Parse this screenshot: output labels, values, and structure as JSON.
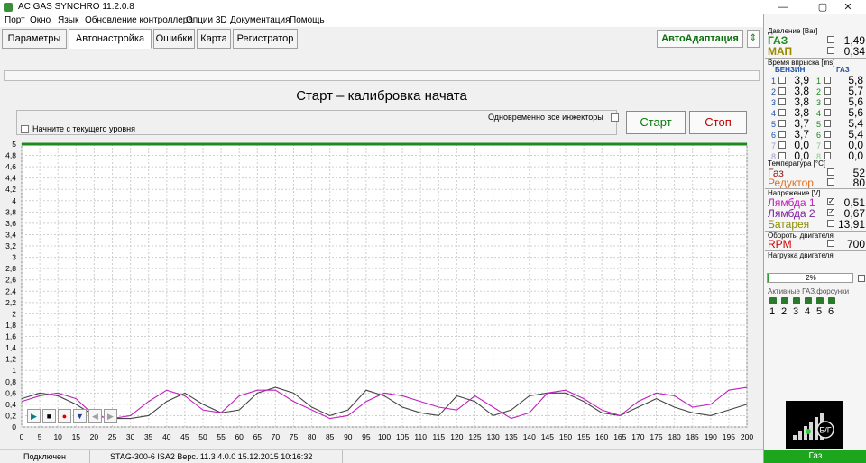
{
  "window": {
    "title": "AC GAS SYNCHRO  11.2.0.8",
    "minimize": "—",
    "maximize": "▢",
    "close": "✕"
  },
  "menu": [
    "Порт",
    "Окно",
    "Язык",
    "Обновление контроллера",
    "Опции 3D",
    "Документация",
    "Помощь"
  ],
  "tabs": [
    {
      "label": "Параметры",
      "active": false
    },
    {
      "label": "Автонастройка",
      "active": true
    },
    {
      "label": "Ошибки",
      "active": false
    },
    {
      "label": "Карта",
      "active": false
    },
    {
      "label": "Регистратор",
      "active": false
    }
  ],
  "toolbar": {
    "auto_adapt": "АвтоАдаптация",
    "scroll_icon": "up-down-arrows-icon"
  },
  "calibration": {
    "title": "Старт – калибровка начата",
    "start_from_level": "Начните с текущего уровня",
    "all_injectors": "Одновременно все инжекторы",
    "start": "Старт",
    "stop": "Стоп"
  },
  "chart_data": {
    "type": "line",
    "xlim": [
      0,
      200
    ],
    "ylim": [
      0,
      5
    ],
    "grid": true,
    "x_ticks": [
      "0",
      "5",
      "10",
      "15",
      "20",
      "25",
      "30",
      "35",
      "40",
      "45",
      "50",
      "55",
      "60",
      "65",
      "70",
      "75",
      "80",
      "85",
      "90",
      "95",
      "100",
      "105",
      "110",
      "115",
      "120",
      "125",
      "130",
      "135",
      "140",
      "145",
      "150",
      "155",
      "160",
      "165",
      "170",
      "175",
      "180",
      "185",
      "190",
      "195",
      "200"
    ],
    "y_ticks": [
      "0",
      "0,2",
      "0,4",
      "0,6",
      "0,8",
      "1",
      "1,2",
      "1,4",
      "1,6",
      "1,8",
      "2",
      "2,2",
      "2,4",
      "2,6",
      "2,8",
      "3",
      "3,2",
      "3,4",
      "3,6",
      "3,8",
      "4",
      "4,2",
      "4,4",
      "4,6",
      "4,8",
      "5"
    ],
    "series": [
      {
        "color": "#444444",
        "x": [
          0,
          5,
          10,
          15,
          20,
          25,
          30,
          35,
          40,
          45,
          50,
          55,
          60,
          65,
          70,
          75,
          80,
          85,
          90,
          95,
          100,
          105,
          110,
          115,
          120,
          125,
          130,
          135,
          140,
          145,
          150,
          155,
          160,
          165,
          170,
          175,
          180,
          185,
          190,
          195,
          200
        ],
        "y": [
          0.5,
          0.6,
          0.55,
          0.4,
          0.2,
          0.15,
          0.15,
          0.2,
          0.45,
          0.6,
          0.4,
          0.25,
          0.3,
          0.6,
          0.7,
          0.6,
          0.35,
          0.2,
          0.3,
          0.65,
          0.55,
          0.35,
          0.25,
          0.2,
          0.55,
          0.45,
          0.2,
          0.3,
          0.55,
          0.6,
          0.6,
          0.45,
          0.25,
          0.2,
          0.35,
          0.5,
          0.35,
          0.25,
          0.2,
          0.3,
          0.4
        ]
      },
      {
        "color": "#c020c0",
        "x": [
          0,
          5,
          10,
          15,
          20,
          25,
          30,
          35,
          40,
          45,
          50,
          55,
          60,
          65,
          70,
          75,
          80,
          85,
          90,
          95,
          100,
          105,
          110,
          115,
          120,
          125,
          130,
          135,
          140,
          145,
          150,
          155,
          160,
          165,
          170,
          175,
          180,
          185,
          190,
          195,
          200
        ],
        "y": [
          0.45,
          0.55,
          0.6,
          0.5,
          0.2,
          0.15,
          0.2,
          0.45,
          0.65,
          0.55,
          0.3,
          0.25,
          0.55,
          0.65,
          0.65,
          0.45,
          0.3,
          0.15,
          0.2,
          0.45,
          0.6,
          0.55,
          0.45,
          0.35,
          0.3,
          0.55,
          0.35,
          0.15,
          0.25,
          0.6,
          0.65,
          0.5,
          0.3,
          0.2,
          0.45,
          0.6,
          0.55,
          0.35,
          0.4,
          0.65,
          0.7
        ]
      }
    ]
  },
  "chart_controls": [
    {
      "name": "play-icon",
      "glyph": "▶",
      "color": "#0b7a8c"
    },
    {
      "name": "stop-square-icon",
      "glyph": "■",
      "color": "#000000"
    },
    {
      "name": "record-icon",
      "glyph": "●",
      "color": "#e00000"
    },
    {
      "name": "scroll-down-icon",
      "glyph": "▼",
      "color": "#1d3e9e"
    },
    {
      "name": "arrow-left-icon",
      "glyph": "◀",
      "color": "#a0a0a0"
    },
    {
      "name": "arrow-right-icon",
      "glyph": "▶",
      "color": "#a0a0a0"
    }
  ],
  "status": {
    "connection": "Подключен",
    "device": "STAG-300-6 ISA2  Верс. 11.3 4.0.0  15.12.2015 10:16:32"
  },
  "panel": {
    "pressure": {
      "title": "Давление [Bar]",
      "gas_label": "ГАЗ",
      "gas_value": "1,49",
      "map_label": "МАП",
      "map_value": "0,34"
    },
    "injection": {
      "title": "Время впрыска [ms]",
      "petrol_header": "БЕНЗИН",
      "gas_header": "ГАЗ",
      "rows": [
        {
          "n": "1",
          "petrol": "3,9",
          "gas": "5,8"
        },
        {
          "n": "2",
          "petrol": "3,8",
          "gas": "5,7"
        },
        {
          "n": "3",
          "petrol": "3,8",
          "gas": "5,6"
        },
        {
          "n": "4",
          "petrol": "3,8",
          "gas": "5,6"
        },
        {
          "n": "5",
          "petrol": "3,7",
          "gas": "5,4"
        },
        {
          "n": "6",
          "petrol": "3,7",
          "gas": "5,4"
        },
        {
          "n": "7",
          "petrol": "0,0",
          "gas": "0,0"
        },
        {
          "n": "8",
          "petrol": "0,0",
          "gas": "0,0"
        }
      ]
    },
    "temperature": {
      "title": "Температура  [°C]",
      "gas_label": "Газ",
      "gas_value": "52",
      "reducer_label": "Редуктор",
      "reducer_value": "80"
    },
    "voltage": {
      "title": "Напряжение [V]",
      "lambda1_label": "Лямбда 1",
      "lambda1_value": "0,51",
      "lambda2_label": "Лямбда 2",
      "lambda2_value": "0,67",
      "battery_label": "Батарея",
      "battery_value": "13,91"
    },
    "rpm": {
      "title": "Обороты двигателя",
      "label": "RPM",
      "value": "700"
    },
    "load": {
      "title": "Нагрузка двигателя",
      "text": "2%",
      "percent": 2
    },
    "nozzles": {
      "title": "Активные ГАЗ.форсунки",
      "labels": [
        "1",
        "2",
        "3",
        "4",
        "5",
        "6"
      ]
    },
    "gauge_label": "Б/Г",
    "gas_status": "Газ"
  }
}
